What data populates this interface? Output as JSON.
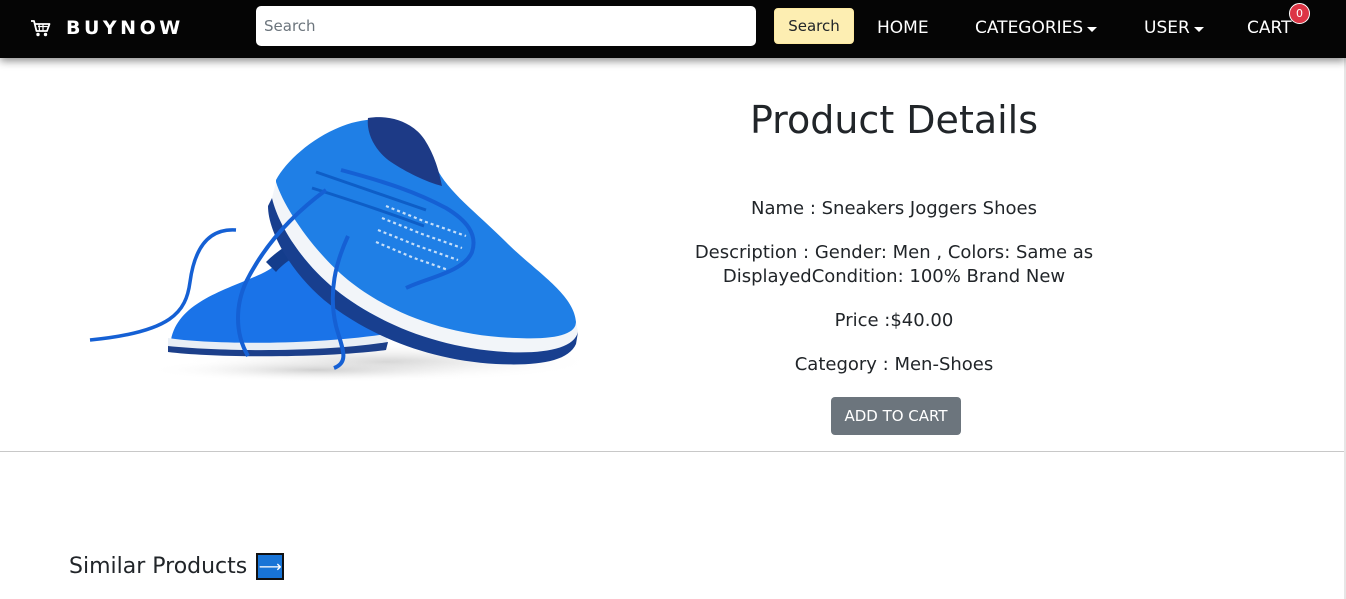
{
  "navbar": {
    "brand": "BUYNOW",
    "brand_icon": "shopping-cart-icon",
    "search": {
      "placeholder": "Search",
      "value": ""
    },
    "search_button": "Search",
    "links": {
      "home": "HOME",
      "categories": "CATEGORIES",
      "user": "USER",
      "cart": "CART"
    },
    "cart_count": "0",
    "background": "#050505",
    "search_button_color": "#fdeeb2",
    "badge_color": "#dc3545"
  },
  "product": {
    "heading": "Product Details",
    "image": "blue-running-sneakers-image",
    "name_line": "Name : Sneakers Joggers Shoes",
    "description_line": "Description : Gender: Men , Colors: Same as DisplayedCondition: 100% Brand New",
    "price_line": "Price :$40.00",
    "category_line": "Category : Men-Shoes",
    "add_to_cart": "ADD TO CART",
    "button_color": "#6c757d"
  },
  "similar": {
    "title": "Similar Products",
    "arrow_icon": "right-arrow-icon",
    "arrow_color": "#1874d6"
  }
}
